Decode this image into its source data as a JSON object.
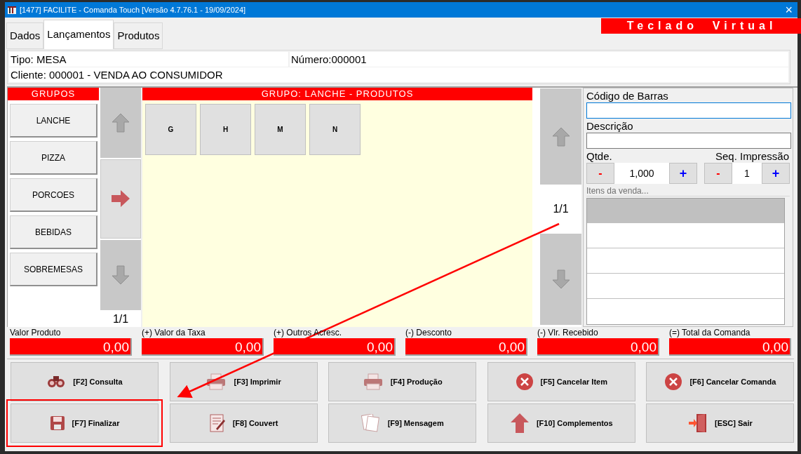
{
  "window": {
    "title": "[1477] FACILITE - Comanda Touch [Versão 4.7.76.1 - 19/09/2024]",
    "close": "×"
  },
  "tabs": [
    {
      "label": "Dados",
      "selected": false
    },
    {
      "label": "Lançamentos",
      "selected": true
    },
    {
      "label": "Produtos",
      "selected": false
    }
  ],
  "keyboard_button": "Teclado  Virtual",
  "header": {
    "tipo": "Tipo: MESA",
    "numero": "Número:000001",
    "cliente": "Cliente: 000001 - VENDA AO CONSUMIDOR"
  },
  "groups": {
    "title": "GRUPOS",
    "items": [
      {
        "label": "LANCHE"
      },
      {
        "label": "PIZZA"
      },
      {
        "label": "PORCOES"
      },
      {
        "label": "BEBIDAS"
      },
      {
        "label": "SOBREMESAS"
      }
    ],
    "pager": "1/1"
  },
  "products": {
    "title": "GRUPO: LANCHE - PRODUTOS",
    "items": [
      {
        "label": "G"
      },
      {
        "label": "H"
      },
      {
        "label": "M"
      },
      {
        "label": "N"
      }
    ],
    "pager": "1/1"
  },
  "entry": {
    "barcode_label": "Código de Barras",
    "description_label": "Descrição",
    "qty_label": "Qtde.",
    "qty_minus": "-",
    "qty_value": "1,000",
    "qty_plus": "+",
    "seq_label": "Seq. Impressão",
    "seq_minus": "-",
    "seq_value": "1",
    "seq_plus": "+",
    "items_legend": "Itens da venda..."
  },
  "totals": [
    {
      "label": "Valor Produto",
      "value": "0,00"
    },
    {
      "label": "(+) Valor da Taxa",
      "value": "0,00"
    },
    {
      "label": "(+) Outros Acresc.",
      "value": "0,00"
    },
    {
      "label": "(-) Desconto",
      "value": "0,00"
    },
    {
      "label": "(-) Vlr. Recebido",
      "value": "0,00"
    },
    {
      "label": "(=) Total da Comanda",
      "value": "0,00"
    }
  ],
  "buttons": [
    {
      "label": "[F2] Consulta",
      "highlighted": false
    },
    {
      "label": "[F3] Imprimir",
      "highlighted": false
    },
    {
      "label": "[F4] Produção",
      "highlighted": false
    },
    {
      "label": "[F5] Cancelar Item",
      "highlighted": false
    },
    {
      "label": "[F6] Cancelar Comanda",
      "highlighted": false
    },
    {
      "label": "[F7] Finalizar",
      "highlighted": true
    },
    {
      "label": "[F8] Couvert",
      "highlighted": false
    },
    {
      "label": "[F9] Mensagem",
      "highlighted": false
    },
    {
      "label": "[F10] Complementos",
      "highlighted": false
    },
    {
      "label": "[ESC] Sair",
      "highlighted": false
    }
  ]
}
